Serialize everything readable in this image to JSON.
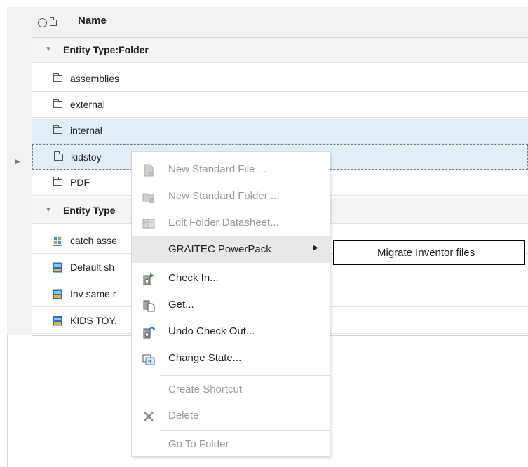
{
  "header": {
    "column_name": "Name",
    "icons": [
      "select-all-icon",
      "document-icon"
    ]
  },
  "groups": [
    {
      "label": "Entity Type:Folder",
      "rows": [
        {
          "name": "assemblies",
          "icon": "folder-icon"
        },
        {
          "name": "external",
          "icon": "folder-icon"
        },
        {
          "name": "internal",
          "icon": "folder-icon",
          "state": "selected"
        },
        {
          "name": "kidstoy",
          "icon": "folder-icon",
          "state": "focused"
        },
        {
          "name": "PDF",
          "icon": "folder-icon"
        }
      ]
    },
    {
      "label": "Entity Type",
      "rows": [
        {
          "name": "catch asse",
          "icon": "assembly-file-icon"
        },
        {
          "name": "Default sh",
          "icon": "inventor-file-icon"
        },
        {
          "name": "Inv same r",
          "icon": "inventor-file-icon"
        },
        {
          "name": "KIDS TOY.",
          "icon": "inventor-file-icon"
        }
      ]
    }
  ],
  "context_menu": {
    "items": [
      {
        "label": "New Standard File ...",
        "icon": "new-file-icon",
        "enabled": false
      },
      {
        "label": "New Standard Folder ...",
        "icon": "new-folder-icon",
        "enabled": false
      },
      {
        "label": "Edit Folder Datasheet...",
        "icon": "datasheet-icon",
        "enabled": false
      },
      {
        "label": "GRAITEC PowerPack",
        "icon": "",
        "enabled": true,
        "submenu": true,
        "highlighted": true
      },
      {
        "label": "Check In...",
        "icon": "check-in-icon",
        "enabled": true
      },
      {
        "label": "Get...",
        "icon": "get-icon",
        "enabled": true
      },
      {
        "label": "Undo Check Out...",
        "icon": "undo-check-out-icon",
        "enabled": true
      },
      {
        "label": "Change State...",
        "icon": "change-state-icon",
        "enabled": true
      },
      {
        "label": "Create Shortcut",
        "icon": "",
        "enabled": false
      },
      {
        "label": "Delete",
        "icon": "delete-icon",
        "enabled": false
      },
      {
        "label": "Go To Folder",
        "icon": "",
        "enabled": false
      }
    ]
  },
  "submenu": {
    "items": [
      {
        "label": "Migrate Inventor files"
      }
    ]
  },
  "colors": {
    "selection": "#e1eef8",
    "header_bg": "#f1f1f1",
    "menu_hover": "#e8e8e8",
    "disabled_text": "#999999"
  }
}
